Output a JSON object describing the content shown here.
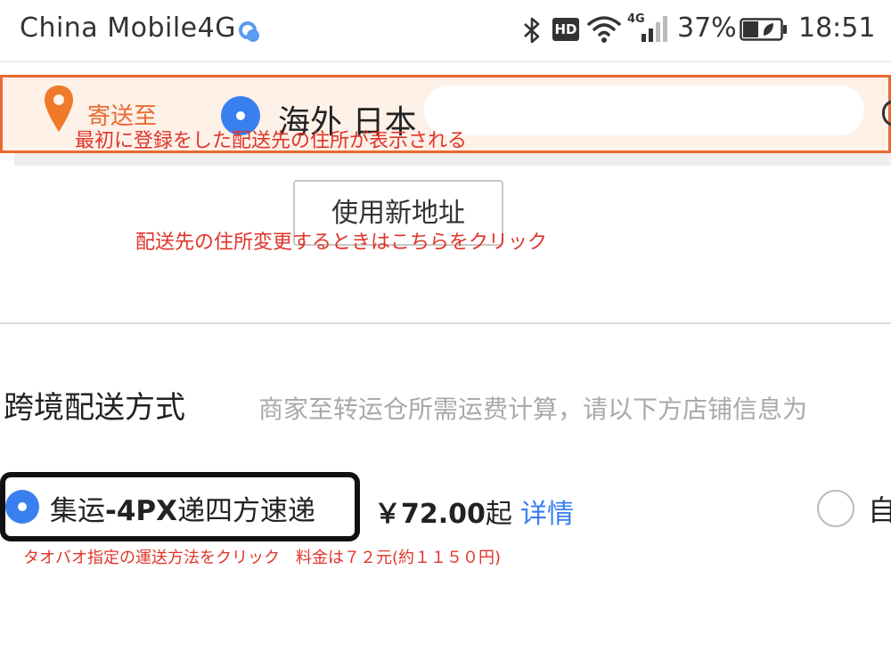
{
  "status_bar": {
    "carrier": "China Mobile4G",
    "hd": "HD",
    "network": "4G",
    "battery": "37%",
    "time": "18:51"
  },
  "address": {
    "ship_to_label": "寄送至",
    "address_text": "海外 日本",
    "note": "最初に登録をした配送先の住所が表示される"
  },
  "new_address": {
    "button_label": "使用新地址",
    "note": "配送先の住所変更するときはこちらをクリック"
  },
  "shipping": {
    "title": "跨境配送方式",
    "hint": "商家至转运仓所需运费计算，请以下方店铺信息为",
    "options": [
      {
        "label_prefix": "集运",
        "label_bold": "-4PX",
        "label_suffix": "递四方速递",
        "price": "￥72.00",
        "price_suffix": "起",
        "detail_link": "详情",
        "selected": true
      },
      {
        "label": "自",
        "selected": false
      }
    ],
    "note": "タオバオ指定の運送方法をクリック　料金は７２元(約１１５０円)"
  },
  "colors": {
    "accent_orange": "#e96a30",
    "annotation_red": "#e0342a",
    "radio_blue": "#3a7ff0",
    "link_blue": "#3a7ff0"
  },
  "icons": {
    "bluetooth": "bluetooth-icon",
    "wifi": "wifi-icon",
    "signal": "signal-icon",
    "battery": "battery-icon",
    "location": "location-pin-icon"
  }
}
